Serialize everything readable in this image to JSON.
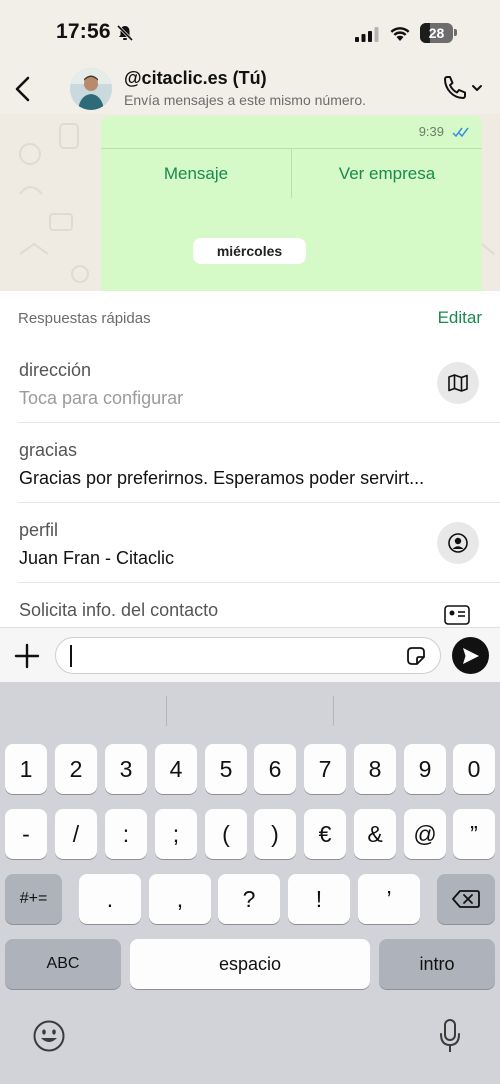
{
  "status": {
    "time": "17:56",
    "battery": "28"
  },
  "header": {
    "contact_name": "@citaclic.es (Tú)",
    "subtitle": "Envía mensajes a este mismo número."
  },
  "chat": {
    "message_time": "9:39",
    "buttons": [
      "Mensaje",
      "Ver empresa"
    ],
    "date_separator": "miércoles"
  },
  "quick_replies": {
    "title": "Respuestas rápidas",
    "edit_label": "Editar",
    "items": [
      {
        "shortcut": "dirección",
        "text": "Toca para configurar",
        "icon": "map-icon"
      },
      {
        "shortcut": "gracias",
        "text": "Gracias por preferirnos. Esperamos poder servirt...",
        "icon": ""
      },
      {
        "shortcut": "perfil",
        "text": "Juan Fran - Citaclic",
        "icon": "profile-icon"
      },
      {
        "shortcut": "Solicita info. del contacto",
        "text": "",
        "icon": "contact-card-icon"
      }
    ]
  },
  "composer": {
    "value": ""
  },
  "keyboard": {
    "row1": [
      "1",
      "2",
      "3",
      "4",
      "5",
      "6",
      "7",
      "8",
      "9",
      "0"
    ],
    "row2": [
      "-",
      "/",
      ":",
      ";",
      "(",
      ")",
      "€",
      "&",
      "@",
      "”"
    ],
    "row3_toggle": "#+=",
    "row3": [
      ".",
      ",",
      "?",
      "!",
      "’"
    ],
    "abc": "ABC",
    "space": "espacio",
    "return": "intro"
  },
  "colors": {
    "accent": "#1a8a4e",
    "bubble": "#d6f9c8",
    "chat_bg": "#efeae2",
    "keyboard_bg": "#d1d3d9"
  }
}
